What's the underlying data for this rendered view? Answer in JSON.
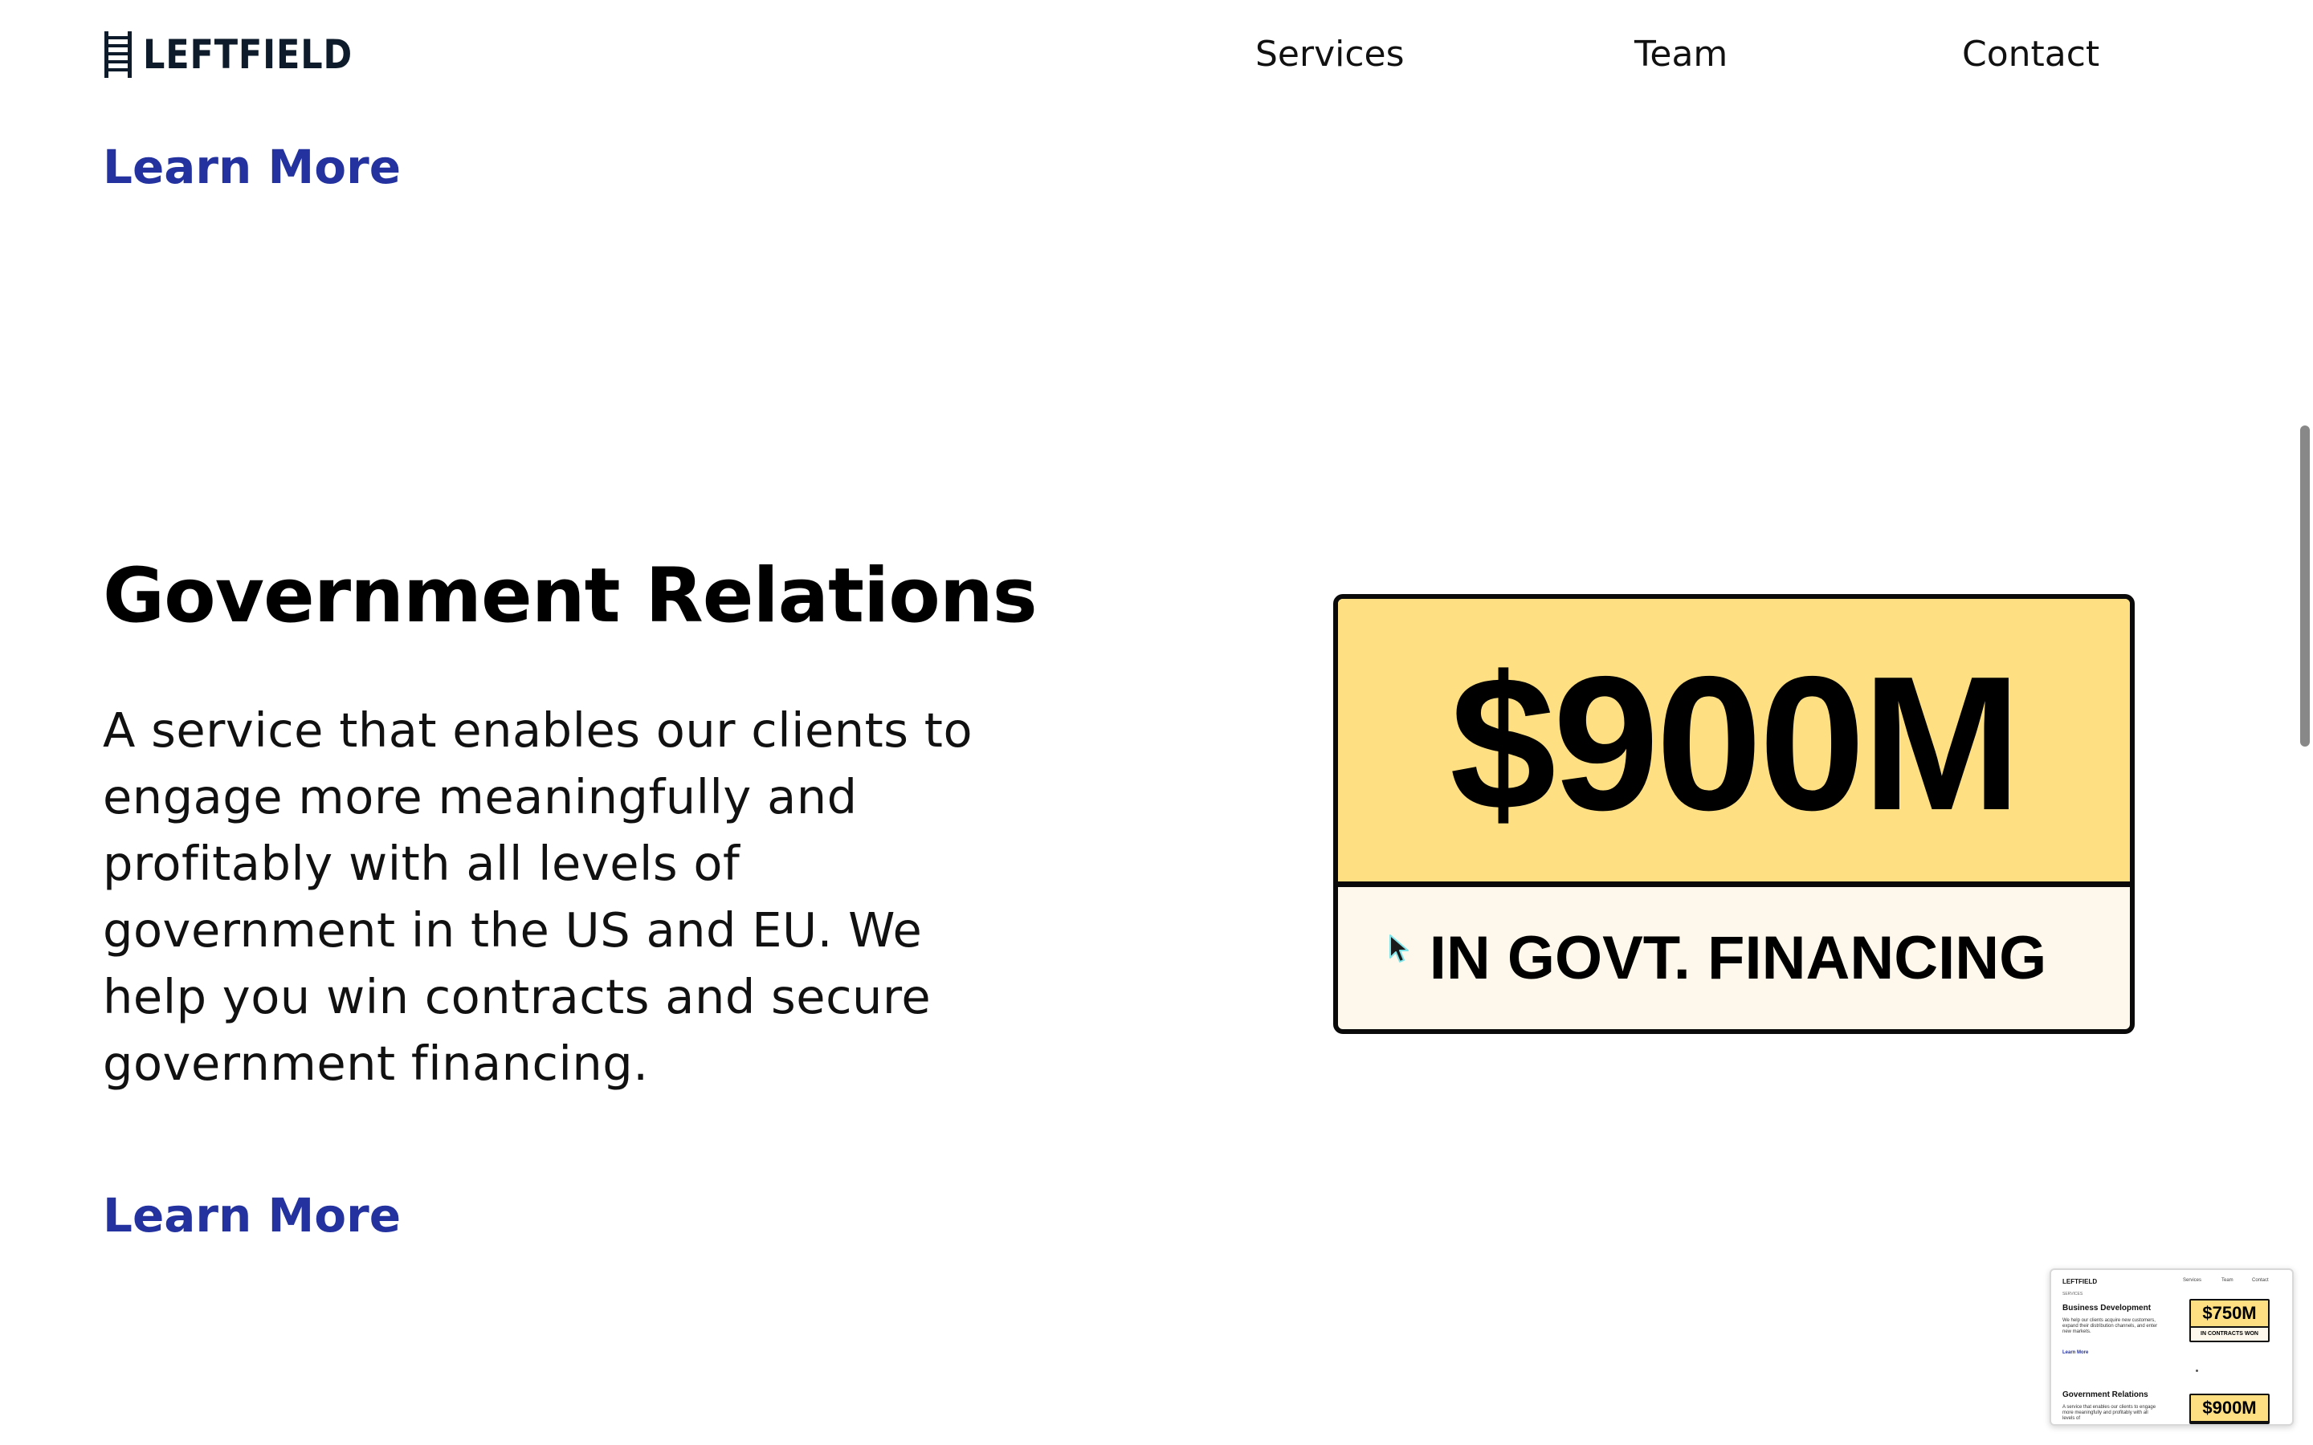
{
  "header": {
    "logo_text": "LEFTFIELD",
    "nav": [
      "Services",
      "Team",
      "Contact"
    ]
  },
  "previous_section": {
    "link": "Learn More"
  },
  "section": {
    "title": "Government Relations",
    "description": "A service that enables our clients to engage more meaningfully and profitably with all levels of government in the US and EU. We help you win contracts and secure government financing.",
    "link": "Learn More"
  },
  "stat_card": {
    "value": "$900M",
    "label": "IN GOVT. FINANCING",
    "top_color": "#fee083",
    "bottom_color": "#fef8ec"
  },
  "minimap": {
    "logo": "LEFTFIELD",
    "nav": [
      "Services",
      "Team",
      "Contact"
    ],
    "eyebrow": "SERVICES",
    "sections": [
      {
        "title": "Business Development",
        "description": "We help our clients acquire new customers, expand their distribution channels, and enter new markets.",
        "link": "Learn More",
        "stat_value": "$750M",
        "stat_label": "IN CONTRACTS WON"
      },
      {
        "title": "Government Relations",
        "description": "A service that enables our clients to engage more meaningfully and profitably with all levels of",
        "stat_value": "$900M"
      }
    ]
  },
  "colors": {
    "link": "#23329f",
    "accent": "#fee083",
    "text": "#111111"
  },
  "icons": [
    "ladder-logo-icon",
    "mouse-pointer-icon"
  ]
}
